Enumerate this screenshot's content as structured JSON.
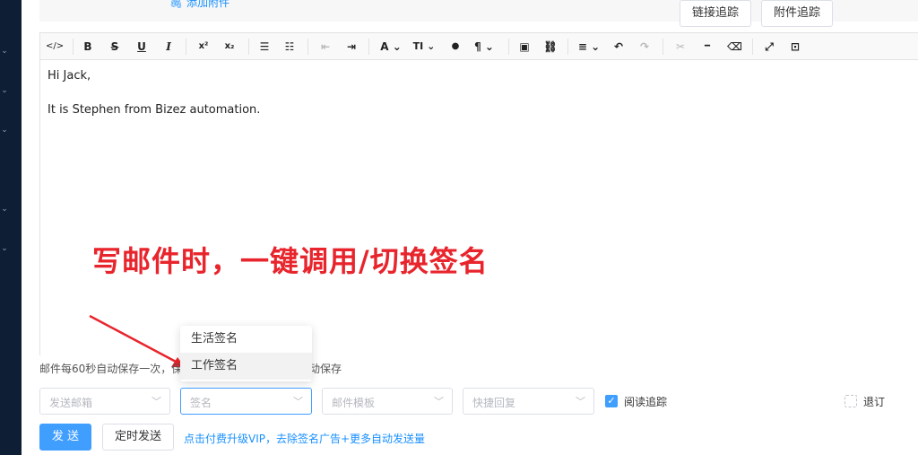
{
  "sidebar": {
    "chevrons": [
      "⌄",
      "⌄",
      "⌄",
      "⌄",
      "⌄"
    ]
  },
  "attachment_link": "🖇 添加附件",
  "toolbar": {
    "code": "</>",
    "bold": "B",
    "strike": "S",
    "underline": "U",
    "italic": "I",
    "superscript": "x²",
    "subscript": "x₂",
    "bullet_list": "☰",
    "ordered_list": "☷",
    "outdent": "⇤",
    "indent": "⇥",
    "font_color": "A ⌄",
    "font_size": "TI ⌄",
    "color_fill": "●",
    "paragraph": "¶ ⌄",
    "image": "▣",
    "link": "⛓",
    "align": "≡ ⌄",
    "undo": "↶",
    "redo": "↷",
    "cut": "✂",
    "hr": "━",
    "eraser": "⌫",
    "fullscreen": "⤢",
    "source": "⊡"
  },
  "editor_body": {
    "line1": "Hi Jack,",
    "line2": "It is Stephen from Bizez automation."
  },
  "annotation_text": "写邮件时，一键调用/切换签名",
  "autosave_hint": "邮件每60秒自动保存一次，保",
  "autosave_hint_tail": "动保存",
  "signature_dropdown": {
    "options": [
      "生活签名",
      "工作签名"
    ]
  },
  "selects": {
    "from_mailbox": "发送邮箱",
    "signature": "签名",
    "template": "邮件模板",
    "quick_reply": "快捷回复"
  },
  "read_tracking_label": "阅读追踪",
  "read_tracking_checked": true,
  "link_tracking_button": "链接追踪",
  "attachment_tracking_button": "附件追踪",
  "unsubscribe_label": "退订",
  "unsubscribe_checked": false,
  "send_button": "发 送",
  "schedule_button": "定时发送",
  "promo_link": "点击付费升级VIP，去除签名广告+更多自动发送量",
  "colors": {
    "primary": "#409eff",
    "annotation": "#e8242c",
    "sidebar": "#0e1f35"
  }
}
